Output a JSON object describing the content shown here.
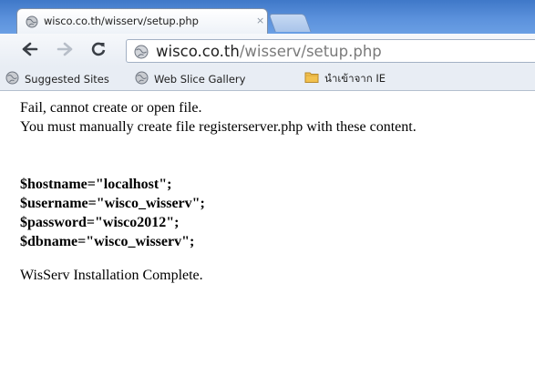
{
  "tab": {
    "title": "wisco.co.th/wisserv/setup.php",
    "close_glyph": "×",
    "favicon": "globe-icon"
  },
  "toolbar": {
    "back": "left-arrow-icon",
    "forward": "right-arrow-icon",
    "reload": "reload-icon",
    "address": {
      "domain": "wisco.co.th",
      "path": "/wisserv/setup.php"
    }
  },
  "bookmarks": [
    {
      "label": "Suggested Sites",
      "icon": "globe-icon"
    },
    {
      "label": "Web Slice Gallery",
      "icon": "globe-icon"
    },
    {
      "label": "นำเข้าจาก IE",
      "icon": "folder-icon"
    }
  ],
  "page": {
    "message1": "Fail, cannot create or open file.",
    "message2": "You must manually create file registerserver.php with these content.",
    "code": [
      "$hostname=\"localhost\";",
      "$username=\"wisco_wisserv\";",
      "$password=\"wisco2012\";",
      "$dbname=\"wisco_wisserv\";"
    ],
    "complete": "WisServ Installation Complete."
  },
  "colors": {
    "titlebar": "#5b91dc",
    "toolbar": "#e8edf4",
    "url_path": "#7a7a7a",
    "folder": "#f2c14e"
  }
}
